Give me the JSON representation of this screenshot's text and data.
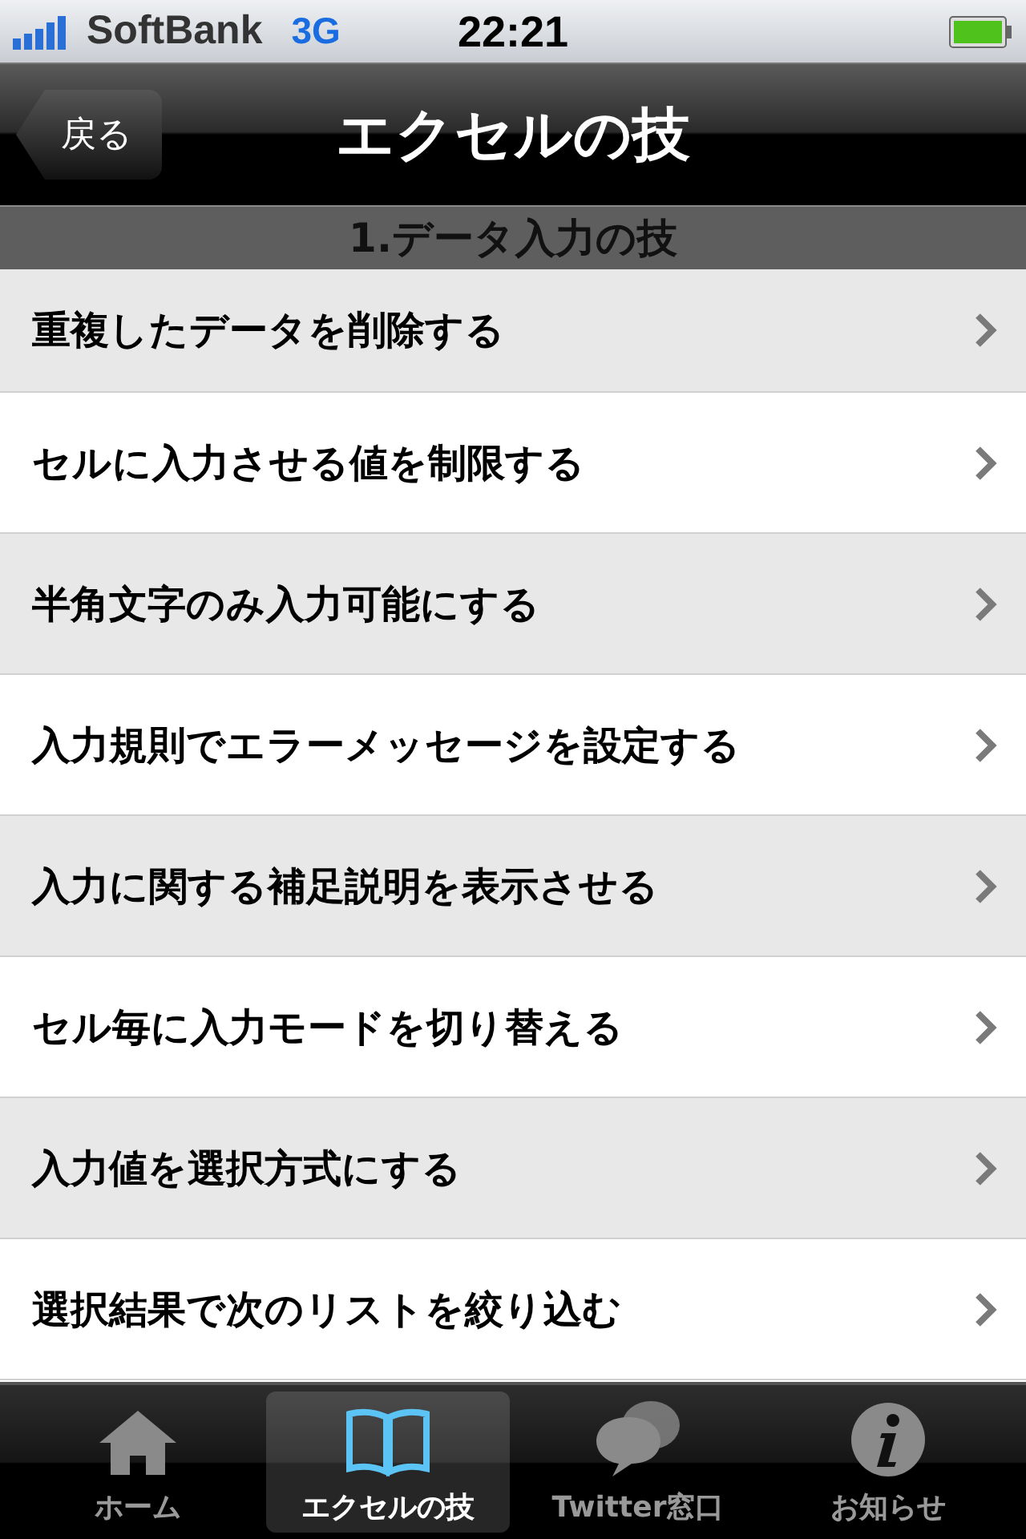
{
  "status_bar": {
    "carrier": "SoftBank",
    "network": "3G",
    "time": "22:21"
  },
  "nav_bar": {
    "back_button": "戻る",
    "title": "エクセルの技"
  },
  "section": {
    "title": "1.データ入力の技"
  },
  "items": [
    {
      "label": "重複したデータを削除する"
    },
    {
      "label": "セルに入力させる値を制限する"
    },
    {
      "label": "半角文字のみ入力可能にする"
    },
    {
      "label": "入力規則でエラーメッセージを設定する"
    },
    {
      "label": "入力に関する補足説明を表示させる"
    },
    {
      "label": "セル毎に入力モードを切り替える"
    },
    {
      "label": "入力値を選択方式にする"
    },
    {
      "label": "選択結果で次のリストを絞り込む"
    }
  ],
  "tab_bar": [
    {
      "label": "ホーム",
      "selected": false
    },
    {
      "label": "エクセルの技",
      "selected": true
    },
    {
      "label": "Twitter窓口",
      "selected": false
    },
    {
      "label": "お知らせ",
      "selected": false
    }
  ]
}
